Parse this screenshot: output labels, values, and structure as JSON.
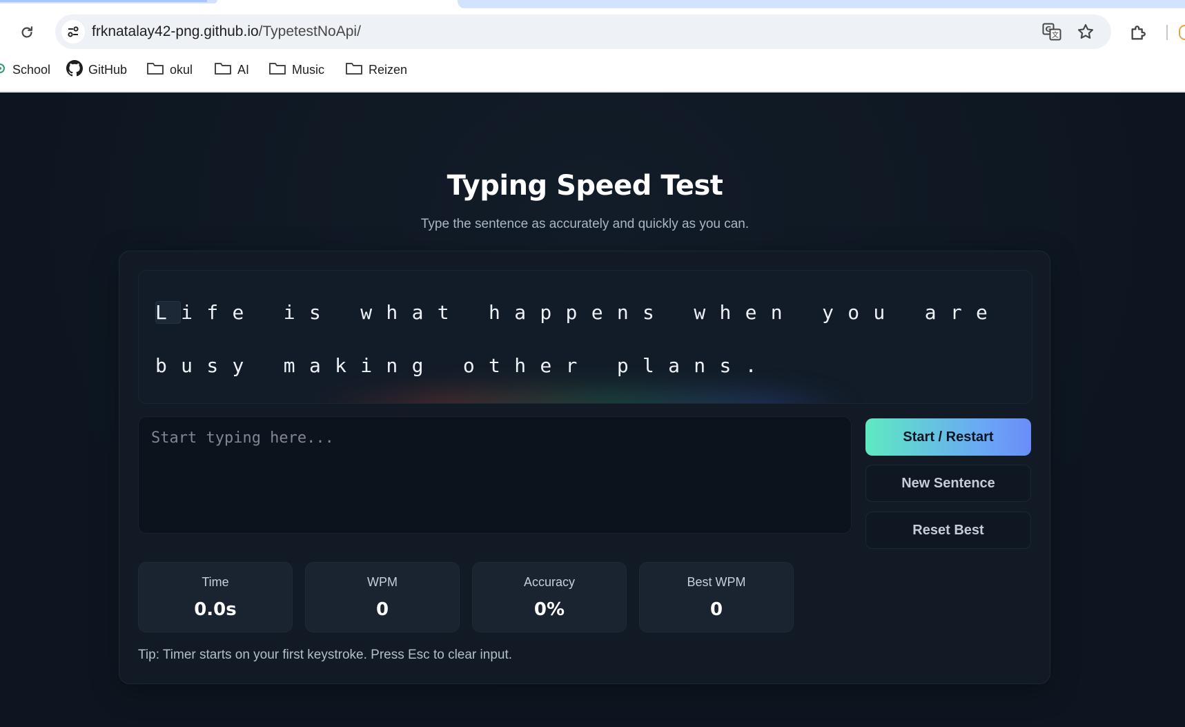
{
  "browser": {
    "url_domain": "frknatalay42-png.github.io",
    "url_path": "/TypetestNoApi/",
    "bookmarks": [
      {
        "label": "School",
        "icon": "school-icon"
      },
      {
        "label": "GitHub",
        "icon": "github-icon"
      },
      {
        "label": "okul",
        "icon": "folder-icon"
      },
      {
        "label": "AI",
        "icon": "folder-icon"
      },
      {
        "label": "Music",
        "icon": "folder-icon"
      },
      {
        "label": "Reizen",
        "icon": "folder-icon"
      }
    ]
  },
  "header": {
    "title": "Typing Speed Test",
    "subtitle": "Type the sentence as accurately and quickly as you can."
  },
  "test": {
    "sentence_first_char": "L",
    "sentence_rest": "ife is what happens when you are busy making other plans.",
    "input_placeholder": "Start typing here...",
    "input_value": ""
  },
  "buttons": {
    "start": "Start / Restart",
    "new_sentence": "New Sentence",
    "reset_best": "Reset Best"
  },
  "stats": {
    "time": {
      "label": "Time",
      "value": "0.0s"
    },
    "wpm": {
      "label": "WPM",
      "value": "0"
    },
    "accuracy": {
      "label": "Accuracy",
      "value": "0%"
    },
    "best_wpm": {
      "label": "Best WPM",
      "value": "0"
    }
  },
  "tip": "Tip: Timer starts on your first keystroke. Press Esc to clear input.",
  "colors": {
    "page_bg": "#0f1822",
    "card_bg": "#111a25",
    "accent_start": "#5eeac1",
    "accent_end": "#6a8df7"
  }
}
